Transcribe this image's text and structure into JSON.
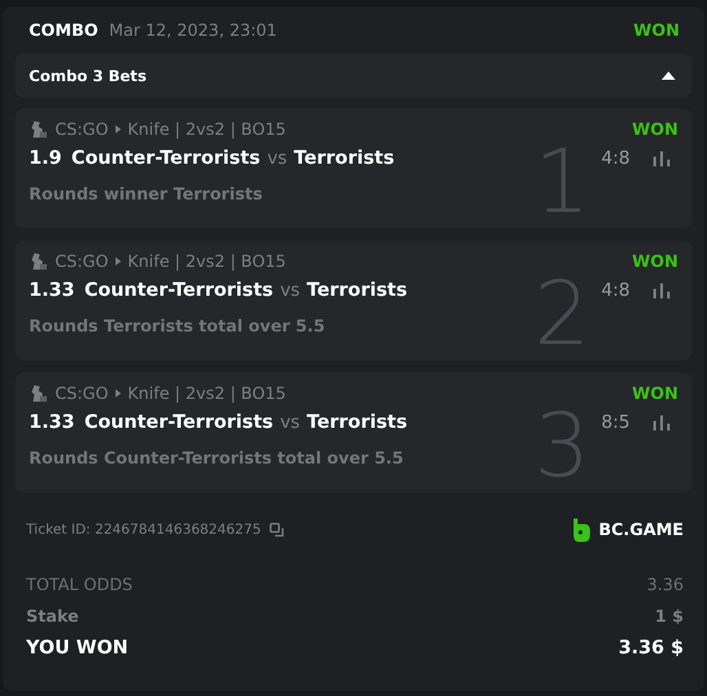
{
  "header": {
    "type": "COMBO",
    "date": "Mar 12, 2023, 23:01",
    "status": "WON"
  },
  "combo": {
    "label": "Combo 3 Bets",
    "expanded": true
  },
  "bets": [
    {
      "game": "CS:GO",
      "path": "Knife | 2vs2 | BO15",
      "status": "WON",
      "odds": "1.9",
      "team1": "Counter-Terrorists",
      "vs": "vs",
      "team2": "Terrorists",
      "score": "4:8",
      "market": "Rounds winner Terrorists",
      "index": "1"
    },
    {
      "game": "CS:GO",
      "path": "Knife | 2vs2 | BO15",
      "status": "WON",
      "odds": "1.33",
      "team1": "Counter-Terrorists",
      "vs": "vs",
      "team2": "Terrorists",
      "score": "4:8",
      "market": "Rounds Terrorists total over 5.5",
      "index": "2"
    },
    {
      "game": "CS:GO",
      "path": "Knife | 2vs2 | BO15",
      "status": "WON",
      "odds": "1.33",
      "team1": "Counter-Terrorists",
      "vs": "vs",
      "team2": "Terrorists",
      "score": "8:5",
      "market": "Rounds Counter-Terrorists total over 5.5",
      "index": "3"
    }
  ],
  "ticket": {
    "id": "Ticket ID: 2246784146368246275",
    "brand": "BC.GAME"
  },
  "totals": [
    {
      "kind": "muted",
      "label": "TOTAL ODDS",
      "value": "3.36"
    },
    {
      "kind": "semi",
      "label": "Stake",
      "value": "1 $"
    },
    {
      "kind": "strong",
      "label": "YOU WON",
      "value": "3.36 $"
    }
  ]
}
